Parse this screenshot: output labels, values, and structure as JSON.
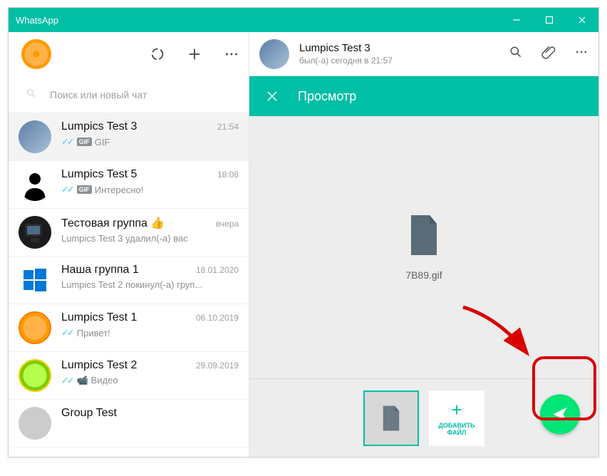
{
  "titlebar": {
    "app_name": "WhatsApp"
  },
  "sidebar": {
    "search_placeholder": "Поиск или новый чат",
    "chats": [
      {
        "name": "Lumpics Test 3",
        "time": "21:54",
        "msg": "GIF",
        "ticks": true,
        "gif": true,
        "active": true,
        "avatar": "blueimg"
      },
      {
        "name": "Lumpics Test 5",
        "time": "18:08",
        "msg": "Интересно!",
        "ticks": true,
        "gif": true,
        "avatar": "suit"
      },
      {
        "name": "Тестовая группа 👍",
        "time": "вчера",
        "msg": "Lumpics Test 3 удалил(-а) вас",
        "avatar": "pc"
      },
      {
        "name": "Наша группа 1",
        "time": "18.01.2020",
        "msg": "Lumpics Test 2 покинул(-а) груп...",
        "avatar": "win"
      },
      {
        "name": "Lumpics Test 1",
        "time": "06.10.2019",
        "msg": "Привет!",
        "ticks": true,
        "avatar": "orange2"
      },
      {
        "name": "Lumpics Test 2",
        "time": "29.09.2019",
        "msg": "📹 Видео",
        "ticks": true,
        "avatar": "green"
      },
      {
        "name": "Group Test",
        "time": "",
        "msg": "",
        "avatar": ""
      }
    ]
  },
  "chat_header": {
    "name": "Lumpics Test 3",
    "status": "был(-а) сегодня в 21:57"
  },
  "preview": {
    "title": "Просмотр",
    "file_name": "7B89.gif",
    "add_file_label": "ДОБАВИТЬ ФАЙЛ"
  }
}
